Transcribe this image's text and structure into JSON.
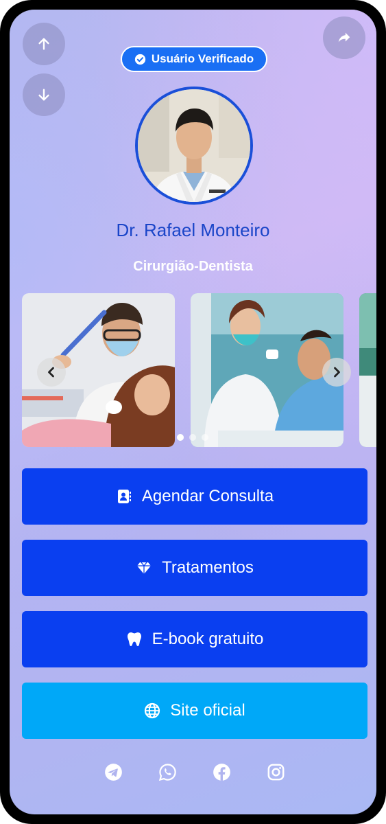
{
  "badge": {
    "label": "Usuário Verificado",
    "icon": "check-circle-icon"
  },
  "profile": {
    "name": "Dr. Rafael Monteiro",
    "role": "Cirurgião-Dentista"
  },
  "carousel": {
    "slides": [
      "dentist-with-patient-photo",
      "dentist-examining-patient-photo",
      "partial-third-photo"
    ],
    "active_index": 0,
    "dot_count": 3
  },
  "buttons": [
    {
      "label": "Agendar Consulta",
      "icon": "address-book-icon",
      "color": "#0a3ff0"
    },
    {
      "label": "Tratamentos",
      "icon": "diamond-icon",
      "color": "#0a3ff0"
    },
    {
      "label": "E-book gratuito",
      "icon": "tooth-icon",
      "color": "#0a3ff0"
    },
    {
      "label": "Site oficial",
      "icon": "globe-icon",
      "color": "#00a8f8"
    }
  ],
  "social": [
    "telegram-icon",
    "whatsapp-icon",
    "facebook-icon",
    "instagram-icon"
  ],
  "colors": {
    "primary": "#0a3ff0",
    "secondary": "#00a8f8",
    "name": "#1a45c8",
    "badge": "#1a6ff4"
  }
}
